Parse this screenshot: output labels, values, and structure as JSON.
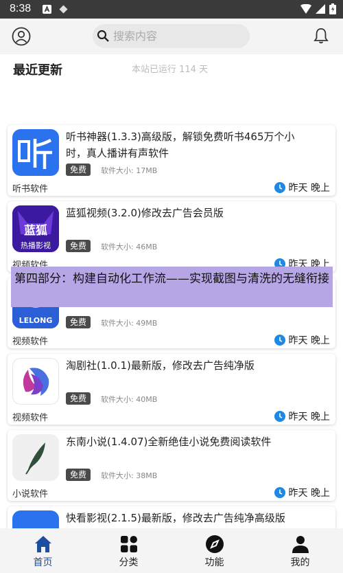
{
  "status_bar": {
    "time": "8:38"
  },
  "header": {
    "search_placeholder": "搜索内容"
  },
  "section": {
    "title": "最近更新",
    "uptime": "本站已运行 114 天"
  },
  "colors": {
    "accent": "#1d4e9f",
    "clock_icon": "#1e88e5",
    "badge": "#4a4a4a",
    "overlay": "#b7a6e6"
  },
  "apps": [
    {
      "title": "听书神器(1.3.3)高级版，解锁免费听书465万个小时，真人播讲有声软件",
      "badge": "免费",
      "size": "软件大小: 17MB",
      "category": "听书软件",
      "time": "昨天 晚上",
      "icon": "ting-app-icon"
    },
    {
      "title": "蓝狐视频(3.2.0)修改去广告会员版",
      "badge": "免费",
      "size": "软件大小: 46MB",
      "category": "视频软件",
      "time": "昨天 晚上",
      "icon": "fox-app-icon",
      "icon_text_1": "蓝狐",
      "icon_text_2": "热播影视"
    },
    {
      "title": "",
      "badge": "免费",
      "size": "软件大小: 49MB",
      "category": "视频软件",
      "time": "昨天 晚上",
      "icon": "lelong-app-icon",
      "icon_text_1": "LELONG"
    },
    {
      "title": "淘剧社(1.0.1)最新版，修改去广告纯净版",
      "badge": "免费",
      "size": "软件大小: 40MB",
      "category": "视频软件",
      "time": "昨天 晚上",
      "icon": "taoju-app-icon"
    },
    {
      "title": "东南小说(1.4.07)全新绝佳小说免费阅读软件",
      "badge": "免费",
      "size": "软件大小: 38MB",
      "category": "小说软件",
      "time": "昨天 晚上",
      "icon": "feather-app-icon"
    },
    {
      "title": "快看影视(2.1.5)最新版，修改去广告纯净高级版",
      "icon": "kuaikan-app-icon"
    }
  ],
  "overlay_text": "第四部分：构建自动化工作流——实现截图与清洗的无缝衔接",
  "bottom_nav": [
    {
      "label": "首页",
      "icon": "home-icon",
      "active": true
    },
    {
      "label": "分类",
      "icon": "grid-icon"
    },
    {
      "label": "功能",
      "icon": "compass-icon"
    },
    {
      "label": "我的",
      "icon": "user-icon"
    }
  ]
}
